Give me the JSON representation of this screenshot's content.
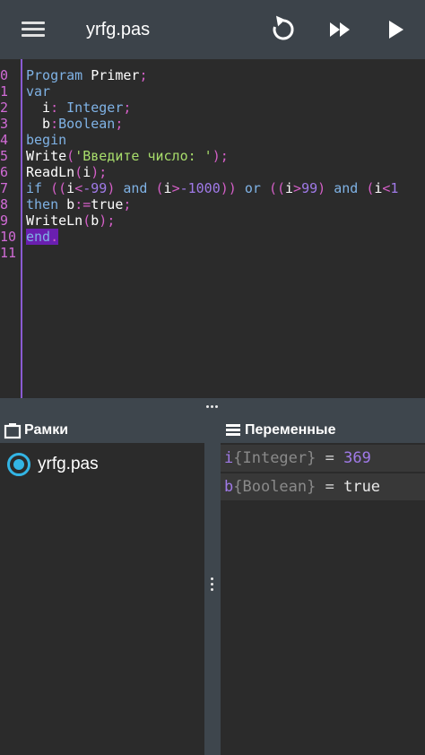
{
  "toolbar": {
    "title": "yrfg.pas",
    "menu_icon": "hamburger-menu-icon",
    "reset_icon": "restart-icon",
    "step_icon": "fast-forward-icon",
    "run_icon": "play-icon"
  },
  "editor": {
    "line_numbers": [
      "0",
      "1",
      "2",
      "3",
      "4",
      "5",
      "6",
      "7",
      "8",
      "9",
      "10",
      "11"
    ],
    "lines": [
      "Program Primer;",
      "var",
      "  i: Integer;",
      "  b:Boolean;",
      "begin",
      "Write('Введите число: ');",
      "ReadLn(i);",
      "if ((i<-99) and (i>-1000)) or ((i>99) and (i<1",
      "then b:=true;",
      "WriteLn(b);",
      "end.",
      ""
    ]
  },
  "frames_panel": {
    "header": "Рамки",
    "icon": "frames-icon",
    "items": [
      {
        "label": "yrfg.pas",
        "selected": true
      }
    ]
  },
  "variables_panel": {
    "header": "Переменные",
    "icon": "variables-list-icon",
    "vars": [
      {
        "name": "i",
        "type": "{Integer}",
        "eq": " = ",
        "value": "369"
      },
      {
        "name": "b",
        "type": "{Boolean}",
        "eq": " = ",
        "value": "true"
      }
    ]
  },
  "colors": {
    "toolbar_bg": "#3c434a",
    "keyword": "#7fb2e5",
    "string": "#a8dd6b",
    "punctuation": "#d45fc7",
    "number": "#a07ae8",
    "selection": "#6a1fb0",
    "radio_accent": "#33b5e5"
  }
}
